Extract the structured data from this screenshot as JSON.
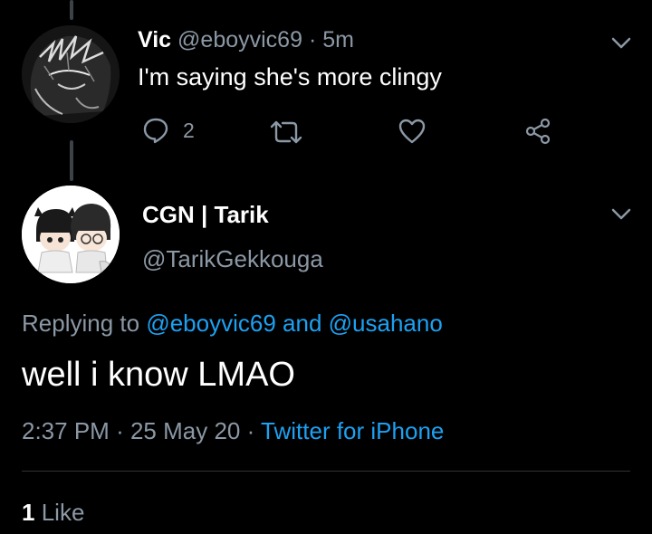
{
  "parent_tweet": {
    "name": "Vic",
    "handle": "@eboyvic69",
    "separator": "·",
    "time": "5m",
    "text": "I'm saying she's more clingy",
    "reply_count": "2"
  },
  "main_tweet": {
    "name": "CGN | Tarik",
    "handle": "@TarikGekkouga",
    "replying_prefix": "Replying to",
    "reply_to_1": "@eboyvic69",
    "reply_and": "and",
    "reply_to_2": "@usahano",
    "text": "well i know LMAO",
    "time": "2:37 PM",
    "sep1": "·",
    "date": "25 May 20",
    "sep2": "·",
    "client": "Twitter for iPhone",
    "like_count": "1",
    "like_label": "Like"
  },
  "colors": {
    "background": "#000000",
    "text": "#ffffff",
    "secondary": "#8b98a5",
    "link": "#1da1f2",
    "divider": "#2f3336"
  }
}
